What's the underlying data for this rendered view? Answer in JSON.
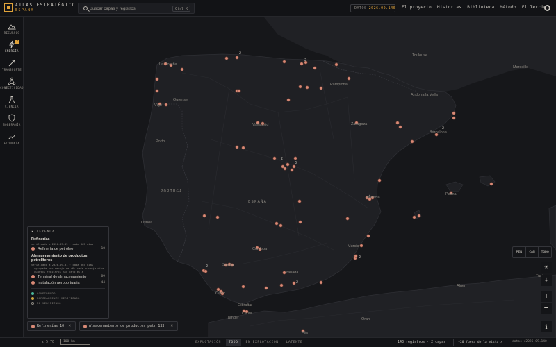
{
  "brand": {
    "title": "ATLAS ESTRATÉGICO",
    "subtitle": "ESPAÑA"
  },
  "search": {
    "placeholder": "Buscar capas y registros",
    "shortcut": "Ctrl K"
  },
  "header": {
    "data_label": "DATOS",
    "data_version": "2026.09.140",
    "nav": [
      "El proyecto",
      "Historias",
      "Biblioteca",
      "Método",
      "El Tercio"
    ],
    "github_icon": "github-icon"
  },
  "sidebar": {
    "items": [
      {
        "label": "RECURSOS",
        "icon": "mountain-icon"
      },
      {
        "label": "ENERGÍA",
        "icon": "bolt-icon",
        "badge": "2",
        "active": true
      },
      {
        "label": "TRANSPORTE",
        "icon": "route-icon"
      },
      {
        "label": "CONECTIVIDAD",
        "icon": "network-icon"
      },
      {
        "label": "CIENCIA",
        "icon": "flask-icon"
      },
      {
        "label": "SOBERANÍA",
        "icon": "shield-icon"
      },
      {
        "label": "ECONOMÍA",
        "icon": "trend-icon"
      }
    ]
  },
  "map": {
    "country_labels": [
      "PORTUGAL",
      "ESPAÑA"
    ],
    "places": [
      "La Coruña",
      "Vigo",
      "Ourense",
      "Porto",
      "Valladolid",
      "Pamplona",
      "Zaragoza",
      "Barcelona",
      "Andorra la Vella",
      "Toulouse",
      "Marseille",
      "Lisboa",
      "Valencia",
      "Palma",
      "Murcia",
      "Córdoba",
      "Sevilla",
      "Granada",
      "Cádiz",
      "Gibraltar",
      "Tanger",
      "Ceuta",
      "Oran",
      "Alger",
      "Tunis",
      "Fès"
    ],
    "marker_color": "#d98a76",
    "cluster_counts": [
      "2",
      "2",
      "3",
      "2",
      "2",
      "2",
      "2",
      "2",
      "2"
    ]
  },
  "legend": {
    "header": "LEYENDA",
    "groups": [
      {
        "title": "Refinerías",
        "meta": "verificado a 2026-09-09 · cada 365 días",
        "items": [
          {
            "label": "Refinería de petróleo",
            "count": "10"
          }
        ]
      },
      {
        "title": "Almacenamiento de productos petrolíferos",
        "meta": "verificado a 2026-09-01 · cada 365 días",
        "note": "agrupada por debajo de z6: cada burbuja dice cuántos registros hay bajo ella",
        "items": [
          {
            "label": "Terminal de almacenamiento",
            "count": "89"
          },
          {
            "label": "Instalación aeroportuaria",
            "count": "44"
          }
        ]
      }
    ],
    "statuses": [
      {
        "label": "CONFIRMADO",
        "color": "#49b59a"
      },
      {
        "label": "PARCIALMENTE VERIFICADO",
        "color": "#c9a441"
      },
      {
        "label": "NO VERIFICADO",
        "color": "#8e8a83"
      }
    ]
  },
  "chips": [
    {
      "label": "Refinerías",
      "count": "10"
    },
    {
      "label": "Almacenamiento de productos petr",
      "count": "133"
    }
  ],
  "projection": {
    "options": [
      "PEN",
      "CAN",
      "TODO"
    ]
  },
  "controls": {
    "sun_icon": "☀",
    "download_icon": "⤓",
    "zoom_in": "+",
    "zoom_out": "−",
    "info_icon": "i"
  },
  "footer": {
    "zoom": "z 5.70",
    "scale": "100 km",
    "modes": [
      "EXPLOTACIÓN",
      "TODO",
      "EN EXPLOTACIÓN",
      "LATENTE"
    ],
    "active_mode": "TODO",
    "count_text": "143 registros · 2 capas",
    "out_of_view": "+20 fuera de la vista ↗",
    "version": "datos·v2026.09.140"
  }
}
